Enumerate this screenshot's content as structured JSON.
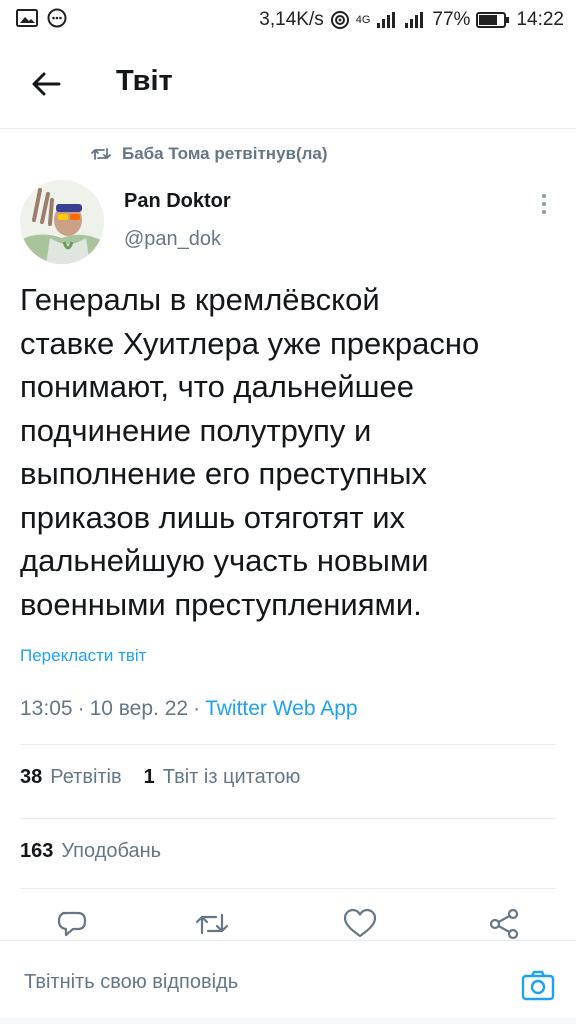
{
  "status_bar": {
    "speed": "3,14K/s",
    "network": "4G",
    "battery": "77%",
    "time": "14:22"
  },
  "header": {
    "title": "Твіт"
  },
  "retweet": {
    "label": "Баба Тома ретвітнув(ла)"
  },
  "author": {
    "name": "Pan Doktor",
    "handle": "@pan_dok"
  },
  "tweet": {
    "text_lines": [
      "Генералы в кремлёвской",
      "ставке Хуитлера уже прекрасно",
      "понимают, что дальнейшее",
      "подчинение полутрупу и",
      "выполнение его преступных",
      "приказов лишь отяготят их",
      "дальнейшую участь новыми",
      "военными преступлениями."
    ],
    "translate": "Перекласти твіт",
    "time": "13:05",
    "date": "10 вер. 22",
    "source": "Twitter Web App"
  },
  "stats": {
    "retweets_count": "38",
    "retweets_label": "Ретвітів",
    "quotes_count": "1",
    "quotes_label": "Твіт із цитатою",
    "likes_count": "163",
    "likes_label": "Уподобань"
  },
  "reply": {
    "placeholder": "Твітніть свою відповідь"
  },
  "colors": {
    "accent": "#1da1f2",
    "secondary_text": "#657786",
    "divider": "#e6ecf0"
  },
  "icons": [
    "image-icon",
    "chat-bubble-icon",
    "wifi-icon",
    "signal-icon",
    "battery-icon",
    "back-arrow-icon",
    "retweet-icon",
    "more-vertical-icon",
    "reply-icon",
    "like-icon",
    "share-icon",
    "camera-icon"
  ]
}
